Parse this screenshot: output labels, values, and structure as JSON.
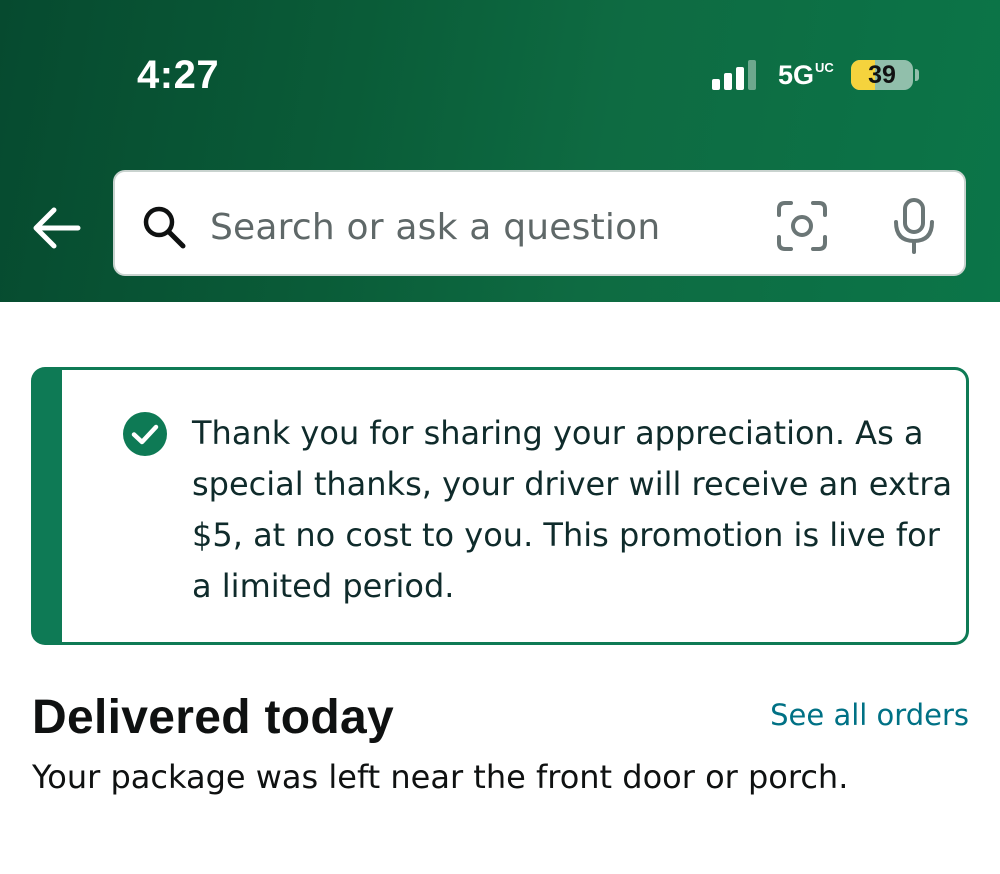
{
  "status_bar": {
    "time": "4:27",
    "network": "5G",
    "network_badge": "UC",
    "battery_level": "39",
    "battery_fraction": 0.39
  },
  "search": {
    "placeholder": "Search or ask a question"
  },
  "icons": {
    "back": "arrow-left-icon",
    "search": "search-icon",
    "camera": "camera-lens-icon",
    "mic": "microphone-icon",
    "check": "check-circle-icon"
  },
  "colors": {
    "header_green": "#0a5c38",
    "accent_green": "#0e7a55",
    "link": "#007185"
  },
  "alert": {
    "message": "Thank you for sharing your appreciation. As a special thanks, your driver will receive an extra $5, at no cost to you. This promotion is live for a limited period."
  },
  "delivery": {
    "title": "Delivered today",
    "see_all_label": "See all orders",
    "subtitle": "Your package was left near the front door or porch."
  }
}
